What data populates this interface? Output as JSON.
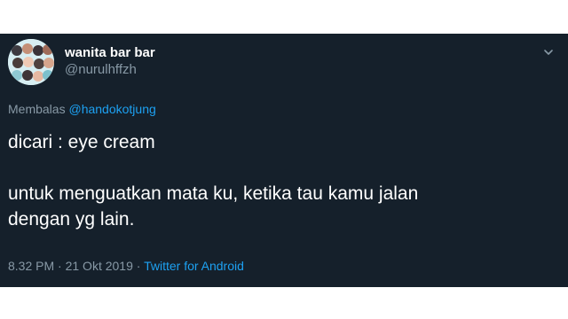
{
  "tweet": {
    "display_name": "wanita bar bar",
    "handle": "@nurulhffzh",
    "reply_prefix": "Membalas",
    "reply_to": "@handokotjung",
    "text_line_1": "dicari : eye cream",
    "text_line_2": "untuk menguatkan mata ku, ketika tau kamu jalan",
    "text_line_3": "dengan yg lain.",
    "time": "8.32 PM",
    "separator_1": "·",
    "date": "21 Okt 2019",
    "separator_2": "·",
    "source": "Twitter for Android"
  },
  "icons": {
    "avatar": "profile-collage-photo",
    "menu": "chevron-down-icon"
  },
  "colors": {
    "background": "#15202b",
    "primary_text": "#ffffff",
    "secondary_text": "#8899a6",
    "link": "#1da1f2"
  }
}
